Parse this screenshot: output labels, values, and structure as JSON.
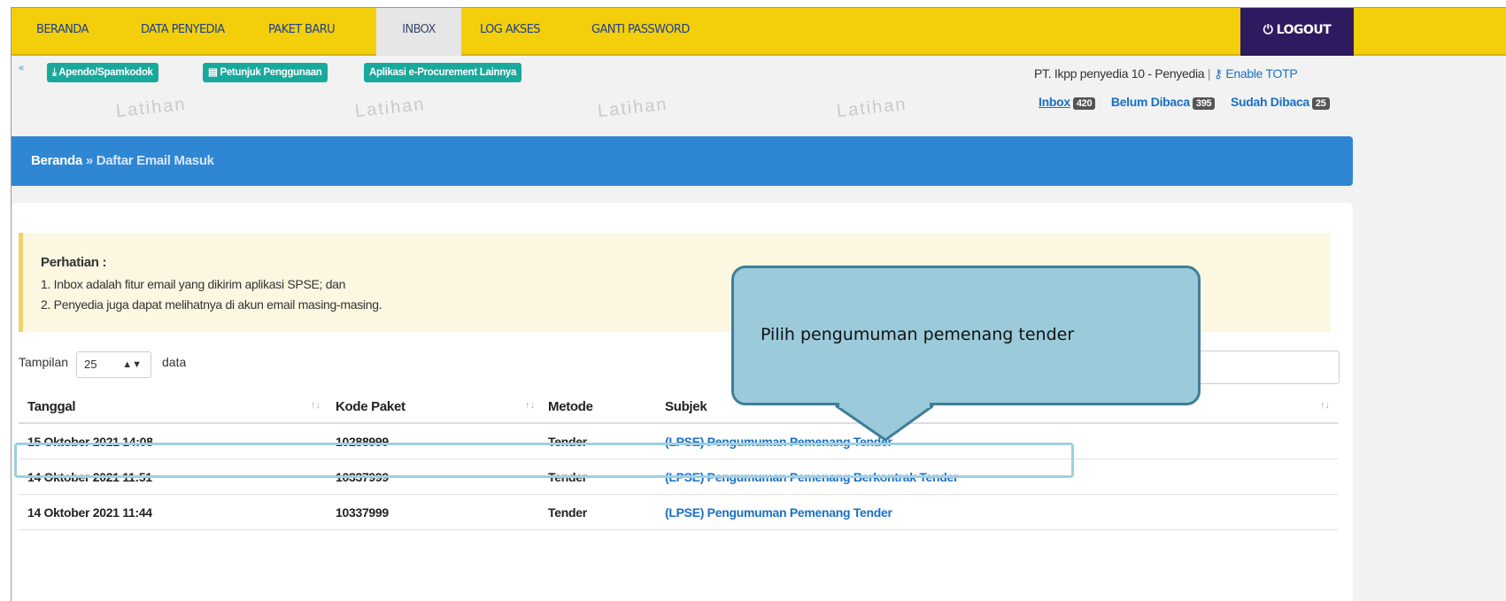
{
  "nav": {
    "items": [
      "BERANDA",
      "DATA PENYEDIA",
      "PAKET BARU",
      "INBOX",
      "LOG AKSES",
      "GANTI PASSWORD"
    ],
    "active": "INBOX",
    "logout": "LOGOUT"
  },
  "subbar": {
    "buttons": [
      "Apendo/Spamkodok",
      "Petunjuk Penggunaan",
      "Aplikasi e-Procurement Lainnya"
    ],
    "user": "PT. Ikpp penyedia 10 - Penyedia",
    "separator": "|",
    "totp": "Enable TOTP"
  },
  "watermark": "Latihan",
  "counters": {
    "inbox_label": "Inbox",
    "inbox_count": "420",
    "unread_label": "Belum Dibaca",
    "unread_count": "395",
    "read_label": "Sudah Dibaca",
    "read_count": "25"
  },
  "breadcrumb": {
    "home": "Beranda",
    "sep": "»",
    "current": "Daftar Email Masuk"
  },
  "notice": {
    "title": "Perhatian :",
    "lines": [
      "1. Inbox adalah fitur email yang dikirim aplikasi SPSE; dan",
      "2. Penyedia juga dapat melihatnya di akun email masing-masing."
    ]
  },
  "length": {
    "label": "Tampilan",
    "value": "25",
    "suffix": "data"
  },
  "table": {
    "headers": [
      "Tanggal",
      "Kode Paket",
      "Metode",
      "Subjek"
    ],
    "rows": [
      {
        "tanggal": "15 Oktober 2021 14:08",
        "kode": "10288999",
        "metode": "Tender",
        "subjek": "(LPSE) Pengumuman Pemenang Tender"
      },
      {
        "tanggal": "14 Oktober 2021 11:51",
        "kode": "10337999",
        "metode": "Tender",
        "subjek": "(LPSE) Pengumuman Pemenang Berkontrak Tender"
      },
      {
        "tanggal": "14 Oktober 2021 11:44",
        "kode": "10337999",
        "metode": "Tender",
        "subjek": "(LPSE) Pengumuman Pemenang Tender"
      }
    ]
  },
  "callout": {
    "text": "Pilih pengumuman pemenang tender"
  },
  "colors": {
    "nav": "#f2cf0a",
    "logout": "#2e1a5e",
    "breadcrumb": "#2f86d3",
    "pill": "#18a99c",
    "link": "#1a6fc4",
    "callout": "#9bcadb"
  }
}
